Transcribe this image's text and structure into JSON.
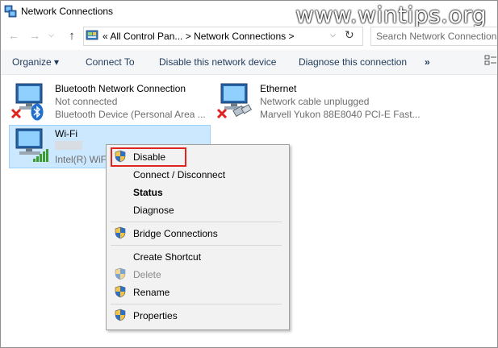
{
  "window": {
    "title": "Network Connections",
    "watermark": "www.wintips.org"
  },
  "navigation": {
    "back_glyph": "←",
    "forward_glyph": "→",
    "recent_glyph": "⌵",
    "up_glyph": "↑",
    "address_path": "«  All Control Pan...  >  Network Connections  >",
    "address_dropdown_glyph": "⌵",
    "refresh_glyph": "↻",
    "search_placeholder": "Search Network Connections"
  },
  "toolbar": {
    "organize": "Organize ▾",
    "connect_to": "Connect To",
    "disable_device": "Disable this network device",
    "diagnose": "Diagnose this connection",
    "more": "»"
  },
  "connections": [
    {
      "name": "Bluetooth Network Connection",
      "status": "Not connected",
      "device": "Bluetooth Device (Personal Area ..."
    },
    {
      "name": "Ethernet",
      "status": "Network cable unplugged",
      "device": "Marvell Yukon 88E8040 PCI-E Fast..."
    },
    {
      "name": "Wi-Fi",
      "device": "Intel(R) WiF"
    }
  ],
  "context_menu": {
    "items": [
      {
        "label": "Disable",
        "shield": true
      },
      {
        "label": "Connect / Disconnect"
      },
      {
        "label": "Status",
        "bold": true
      },
      {
        "label": "Diagnose"
      },
      {
        "label": "Bridge Connections",
        "shield": true
      },
      {
        "label": "Create Shortcut"
      },
      {
        "label": "Delete",
        "shield": true,
        "disabled": true
      },
      {
        "label": "Rename",
        "shield": true
      },
      {
        "label": "Properties",
        "shield": true
      }
    ]
  },
  "colors": {
    "selection_fill": "#cce8ff",
    "highlight_box": "#e0241f",
    "link_text": "#1e395b",
    "status_text": "#6d6d6d"
  }
}
